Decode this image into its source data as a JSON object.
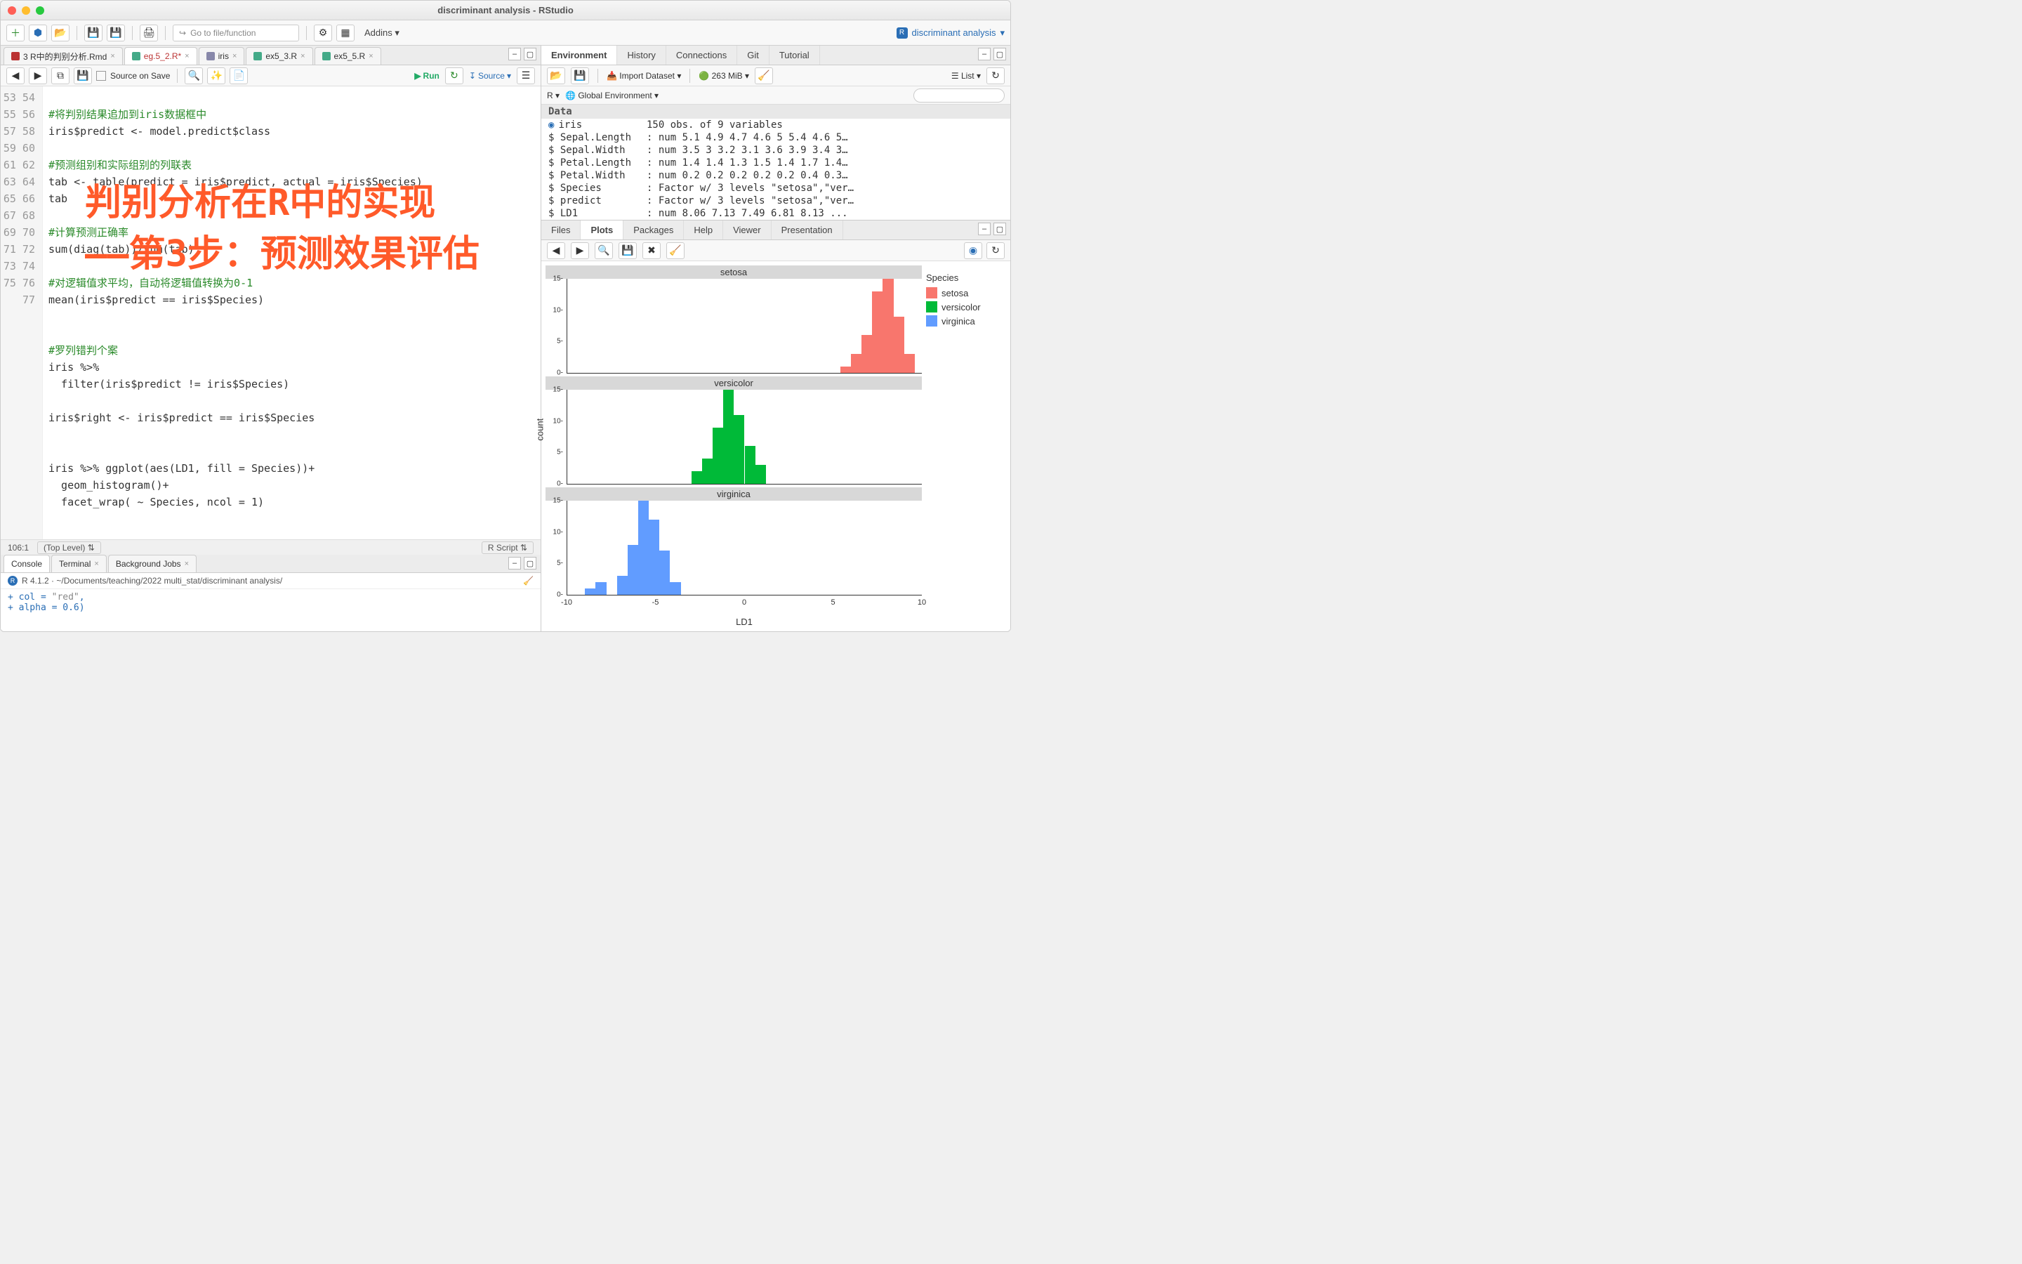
{
  "window_title": "discriminant analysis - RStudio",
  "project_name": "discriminant analysis",
  "goto_placeholder": "Go to file/function",
  "addins_label": "Addins",
  "source_tabs": [
    {
      "label": "3 R中的判别分析.Rmd",
      "icon": "rmd"
    },
    {
      "label": "eg.5_2.R*",
      "icon": "r",
      "active": true,
      "color": "#b33"
    },
    {
      "label": "iris",
      "icon": "tbl"
    },
    {
      "label": "ex5_3.R",
      "icon": "r"
    },
    {
      "label": "ex5_5.R",
      "icon": "r"
    }
  ],
  "source_on_save": "Source on Save",
  "run_label": "Run",
  "source_label": "Source",
  "editor_lines": [
    {
      "n": 53,
      "t": ""
    },
    {
      "n": 54,
      "t": "#将判别结果追加到iris数据框中",
      "cls": "c-comment"
    },
    {
      "n": 55,
      "t": "iris$predict <- model.predict$class"
    },
    {
      "n": 56,
      "t": ""
    },
    {
      "n": 57,
      "t": "#预测组别和实际组别的列联表",
      "cls": "c-comment"
    },
    {
      "n": 58,
      "t": "tab <- table(predict = iris$predict, actual = iris$Species)"
    },
    {
      "n": 59,
      "t": "tab"
    },
    {
      "n": 60,
      "t": ""
    },
    {
      "n": 61,
      "t": "#计算预测正确率",
      "cls": "c-comment"
    },
    {
      "n": 62,
      "t": "sum(diag(tab))/sum(tab)"
    },
    {
      "n": 63,
      "t": ""
    },
    {
      "n": 64,
      "t": "#对逻辑值求平均，自动将逻辑值转换为0-1",
      "cls": "c-comment"
    },
    {
      "n": 65,
      "t": "mean(iris$predict == iris$Species)"
    },
    {
      "n": 66,
      "t": ""
    },
    {
      "n": 67,
      "t": ""
    },
    {
      "n": 68,
      "t": "#罗列错判个案",
      "cls": "c-comment"
    },
    {
      "n": 69,
      "t": "iris %>%"
    },
    {
      "n": 70,
      "t": "  filter(iris$predict != iris$Species)"
    },
    {
      "n": 71,
      "t": ""
    },
    {
      "n": 72,
      "t": "iris$right <- iris$predict == iris$Species"
    },
    {
      "n": 73,
      "t": ""
    },
    {
      "n": 74,
      "t": ""
    },
    {
      "n": 75,
      "t": "iris %>% ggplot(aes(LD1, fill = Species))+"
    },
    {
      "n": 76,
      "t": "  geom_histogram()+"
    },
    {
      "n": 77,
      "t": "  facet_wrap( ~ Species, ncol = 1)"
    }
  ],
  "status_pos": "106:1",
  "status_scope": "(Top Level)",
  "status_type": "R Script",
  "console_tabs": [
    "Console",
    "Terminal",
    "Background Jobs"
  ],
  "console_version": "R 4.1.2 · ~/Documents/teaching/2022 multi_stat/discriminant analysis/",
  "console_lines": [
    "+           col = \"red\",",
    "+           alpha = 0.6)"
  ],
  "env_tabs": [
    "Environment",
    "History",
    "Connections",
    "Git",
    "Tutorial"
  ],
  "import_label": "Import Dataset",
  "mem_label": "263 MiB",
  "list_label": "List",
  "env_scope_r": "R",
  "env_scope": "Global Environment",
  "env_section": "Data",
  "env_rows": [
    {
      "k": "iris",
      "v": "150 obs. of 9 variables",
      "top": true
    },
    {
      "k": "$ Sepal.Length",
      "v": ": num  5.1 4.9 4.7 4.6 5 5.4 4.6 5…"
    },
    {
      "k": "$ Sepal.Width ",
      "v": ": num  3.5 3 3.2 3.1 3.6 3.9 3.4 3…"
    },
    {
      "k": "$ Petal.Length",
      "v": ": num  1.4 1.4 1.3 1.5 1.4 1.7 1.4…"
    },
    {
      "k": "$ Petal.Width ",
      "v": ": num  0.2 0.2 0.2 0.2 0.2 0.4 0.3…"
    },
    {
      "k": "$ Species     ",
      "v": ": Factor w/ 3 levels \"setosa\",\"ver…"
    },
    {
      "k": "$ predict     ",
      "v": ": Factor w/ 3 levels \"setosa\",\"ver…"
    },
    {
      "k": "$ LD1         ",
      "v": ": num  8.06 7.13 7.49 6.81 8.13 ..."
    }
  ],
  "plot_tabs": [
    "Files",
    "Plots",
    "Packages",
    "Help",
    "Viewer",
    "Presentation"
  ],
  "overlay": {
    "line1": "判别分析在R中的实现",
    "line2": "——第3步：预测效果评估"
  },
  "chart_data": {
    "type": "bar",
    "xlabel": "LD1",
    "ylabel": "count",
    "xlim": [
      -10,
      10
    ],
    "ylim": [
      0,
      15
    ],
    "xticks": [
      -10,
      -5,
      0,
      5,
      10
    ],
    "yticks": [
      0,
      5,
      10,
      15
    ],
    "binwidth": 0.6,
    "legend_title": "Species",
    "facets": [
      {
        "name": "setosa",
        "color": "#f8766d",
        "bars": [
          {
            "x": 5.4,
            "y": 1
          },
          {
            "x": 6.0,
            "y": 3
          },
          {
            "x": 6.6,
            "y": 6
          },
          {
            "x": 7.2,
            "y": 13
          },
          {
            "x": 7.8,
            "y": 15
          },
          {
            "x": 8.4,
            "y": 9
          },
          {
            "x": 9.0,
            "y": 3
          }
        ]
      },
      {
        "name": "versicolor",
        "color": "#00ba38",
        "bars": [
          {
            "x": -3.0,
            "y": 2
          },
          {
            "x": -2.4,
            "y": 4
          },
          {
            "x": -1.8,
            "y": 9
          },
          {
            "x": -1.2,
            "y": 15
          },
          {
            "x": -0.6,
            "y": 11
          },
          {
            "x": 0.0,
            "y": 6
          },
          {
            "x": 0.6,
            "y": 3
          }
        ]
      },
      {
        "name": "virginica",
        "color": "#619cff",
        "bars": [
          {
            "x": -9.0,
            "y": 1
          },
          {
            "x": -8.4,
            "y": 2
          },
          {
            "x": -7.2,
            "y": 3
          },
          {
            "x": -6.6,
            "y": 8
          },
          {
            "x": -6.0,
            "y": 15
          },
          {
            "x": -5.4,
            "y": 12
          },
          {
            "x": -4.8,
            "y": 7
          },
          {
            "x": -4.2,
            "y": 2
          }
        ]
      }
    ]
  }
}
